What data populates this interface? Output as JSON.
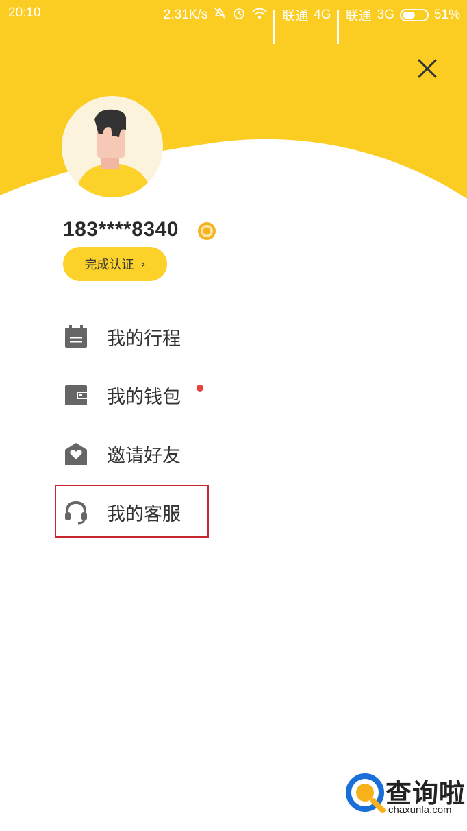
{
  "status_bar": {
    "time": "20:10",
    "speed": "2.31K/s",
    "carrier1": "联通",
    "net1": "4G",
    "carrier2": "联通",
    "net2": "3G",
    "battery": "51%"
  },
  "profile": {
    "phone": "183****8340",
    "verify_label": "完成认证",
    "verify_chevron": "›"
  },
  "menu": [
    {
      "label": "我的行程",
      "icon": "calendar-icon",
      "has_dot": false
    },
    {
      "label": "我的钱包",
      "icon": "wallet-icon",
      "has_dot": true
    },
    {
      "label": "邀请好友",
      "icon": "invite-heart-icon",
      "has_dot": false
    },
    {
      "label": "我的客服",
      "icon": "headset-icon",
      "has_dot": false,
      "highlighted": true
    }
  ],
  "watermark": {
    "cn": "查询啦",
    "en": "chaxunla.com"
  },
  "colors": {
    "brand_yellow": "#fbcd23",
    "icon_gray": "#666666",
    "notify_red": "#e8423c",
    "highlight_red": "#c7282f"
  }
}
